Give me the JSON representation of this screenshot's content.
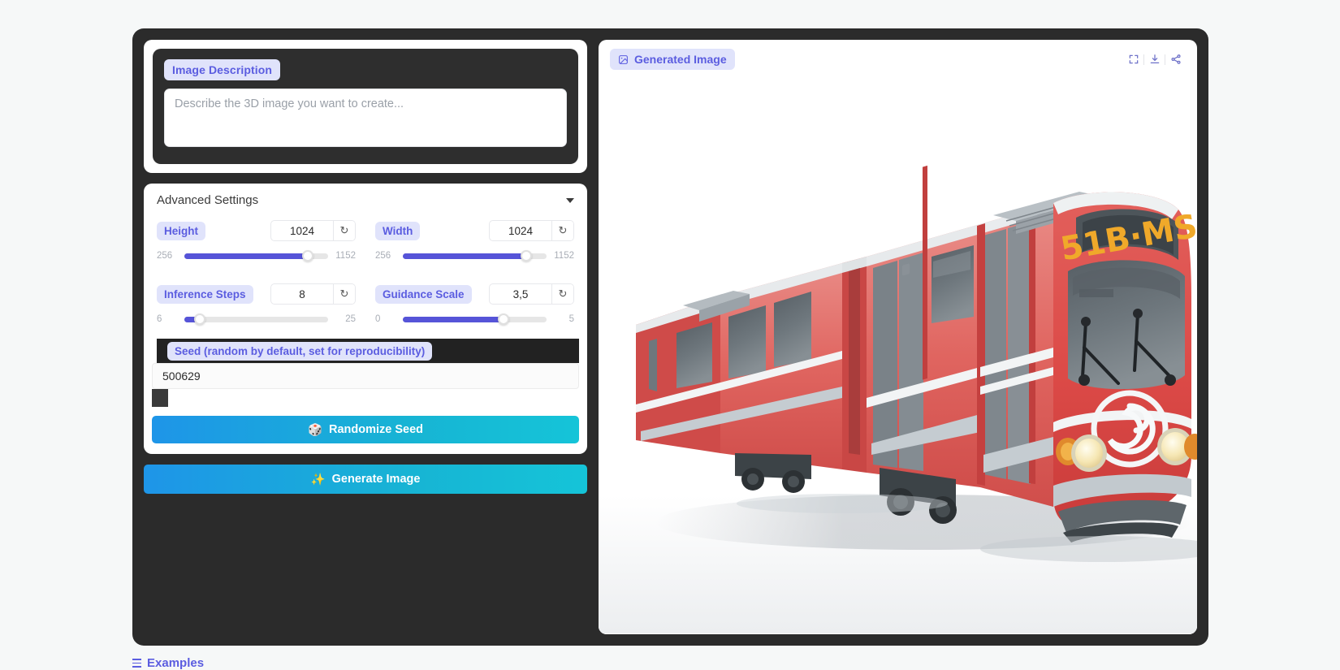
{
  "app": {
    "background_color": "#f6f8f8",
    "shell_color": "#2b2b2b",
    "accent_color": "#5b5de0",
    "accent_bg": "#e0e3fb",
    "slider_fill": "#5654d8",
    "button_gradient_from": "#1e95e8",
    "button_gradient_to": "#15c4d8"
  },
  "prompt": {
    "label": "Image Description",
    "placeholder": "Describe the 3D image you want to create...",
    "value": ""
  },
  "advanced": {
    "title": "Advanced Settings",
    "expanded": true,
    "chevron_icon": "chevron-down-icon",
    "reset_icon": "reset-icon",
    "controls": [
      {
        "name": "height",
        "label": "Height",
        "value": "1024",
        "min_label": "256",
        "max_label": "1152",
        "min": 256,
        "max": 1152,
        "current": 1024,
        "fill_percent": 86
      },
      {
        "name": "width",
        "label": "Width",
        "value": "1024",
        "min_label": "256",
        "max_label": "1152",
        "min": 256,
        "max": 1152,
        "current": 1024,
        "fill_percent": 86
      },
      {
        "name": "inference-steps",
        "label": "Inference Steps",
        "value": "8",
        "min_label": "6",
        "max_label": "25",
        "min": 6,
        "max": 25,
        "current": 8,
        "fill_percent": 11
      },
      {
        "name": "guidance-scale",
        "label": "Guidance Scale",
        "value": "3,5",
        "min_label": "0",
        "max_label": "5",
        "min": 0,
        "max": 5,
        "current": 3.5,
        "fill_percent": 70
      }
    ]
  },
  "seed": {
    "label": "Seed (random by default, set for reproducibility)",
    "value": "500629",
    "randomize_label": "Randomize Seed",
    "randomize_icon": "dice-icon"
  },
  "generate": {
    "label": "Generate Image",
    "icon": "sparkles-icon"
  },
  "examples": {
    "label": "Examples",
    "icon": "list-icon"
  },
  "output": {
    "title": "Generated Image",
    "title_icon": "image-icon",
    "tools": [
      {
        "name": "fullscreen-button",
        "icon": "fullscreen-icon"
      },
      {
        "name": "download-button",
        "icon": "download-icon"
      },
      {
        "name": "share-button",
        "icon": "share-icon"
      }
    ],
    "image": {
      "subject": "Red articulated tram / light rail vehicle, 3D render on white background",
      "destination_sign": "51B·MS",
      "body_color": "#de4a48",
      "body_color_light": "#e8706d",
      "roof_color": "#e9ecee",
      "window_color": "#6e777c",
      "sign_text_color": "#f0a92a",
      "skirt_color": "#b9c0c4"
    }
  }
}
